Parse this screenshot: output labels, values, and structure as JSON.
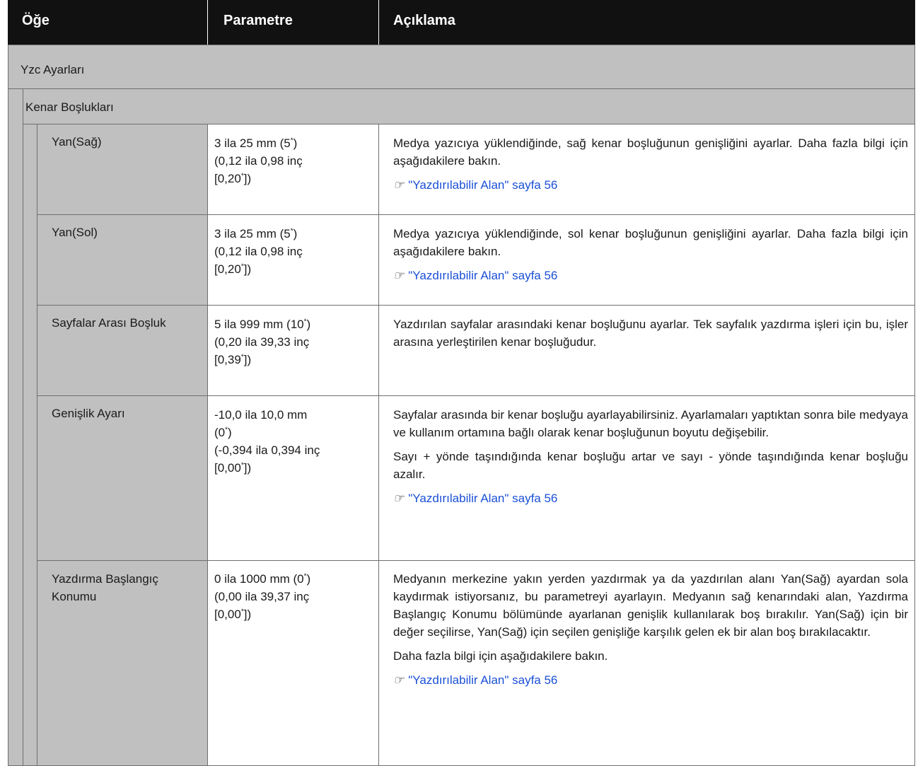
{
  "header": {
    "col_item": "Öğe",
    "col_param": "Parametre",
    "col_desc": "Açıklama"
  },
  "section": "Yzc Ayarları",
  "subsection": "Kenar Boşlukları",
  "rows": [
    {
      "item": "Yan(Sağ)",
      "param": [
        "3 ila 25 mm (5",
        "*",
        ")",
        "(0,12 ila 0,98 inç",
        "[0,20",
        "*",
        "])"
      ],
      "desc": "Medya yazıcıya yüklendiğinde, sağ kenar boşluğunun genişliğini ayarlar. Daha fazla bilgi için aşağıdakilere bakın.",
      "link": "\"Yazdırılabilir Alan\" sayfa 56"
    },
    {
      "item": "Yan(Sol)",
      "param": [
        "3 ila 25 mm (5",
        "*",
        ")",
        "(0,12 ila 0,98 inç",
        "[0,20",
        "*",
        "])"
      ],
      "desc": "Medya yazıcıya yüklendiğinde, sol kenar boşluğunun genişliğini ayarlar. Daha fazla bilgi için aşağıdakilere bakın.",
      "link": "\"Yazdırılabilir Alan\" sayfa 56"
    },
    {
      "item": "Sayfalar Arası Boşluk",
      "param": [
        "5 ila 999 mm (10",
        "*",
        ")",
        "(0,20 ila 39,33 inç",
        "[0,39",
        "*",
        "])"
      ],
      "desc": "Yazdırılan sayfalar arasındaki kenar boşluğunu ayarlar. Tek sayfalık yazdırma işleri için bu, işler arasına yerleştirilen kenar boşluğudur."
    },
    {
      "item": "Genişlik Ayarı",
      "param": [
        "-10,0 ila 10,0 mm",
        "0",
        "*",
        ")",
        "(-0,394 ila 0,394 inç",
        "[0,00",
        "*",
        "])"
      ],
      "desc": "Sayfalar arasında bir kenar boşluğu ayarlayabilirsiniz. Ayarlamaları yaptıktan sonra bile medyaya ve kullanım ortamına bağlı olarak kenar boşluğunun boyutu değişebilir.",
      "desc2": "Sayı + yönde taşındığında kenar boşluğu artar ve sayı - yönde taşındığında kenar boşluğu azalır.",
      "link": "\"Yazdırılabilir Alan\" sayfa 56"
    },
    {
      "item": "Yazdırma Başlangıç Konumu",
      "param": [
        "0 ila 1000 mm (0",
        "*",
        ")",
        "(0,00 ila 39,37 inç",
        "[0,00",
        "*",
        "])"
      ],
      "desc": "Medyanın merkezine yakın yerden yazdırmak ya da yazdırılan alanı Yan(Sağ) ayardan sola kaydırmak istiyorsanız, bu parametreyi ayarlayın. Medyanın sağ kenarındaki alan, Yazdırma Başlangıç Konumu bölümünde ayarlanan genişlik kullanılarak boş bırakılır. Yan(Sağ) için bir değer seçilirse, Yan(Sağ) için seçilen genişliğe karşılık gelen ek bir alan boş bırakılacaktır.",
      "desc2": "Daha fazla bilgi için aşağıdakilere bakın.",
      "link": "\"Yazdırılabilir Alan\" sayfa 56"
    }
  ],
  "colors": {
    "header_bg": "#111111",
    "section_bg": "#c0c0c0",
    "link": "#1a4fd6"
  },
  "icons": {
    "link": "reference-hand-icon"
  }
}
